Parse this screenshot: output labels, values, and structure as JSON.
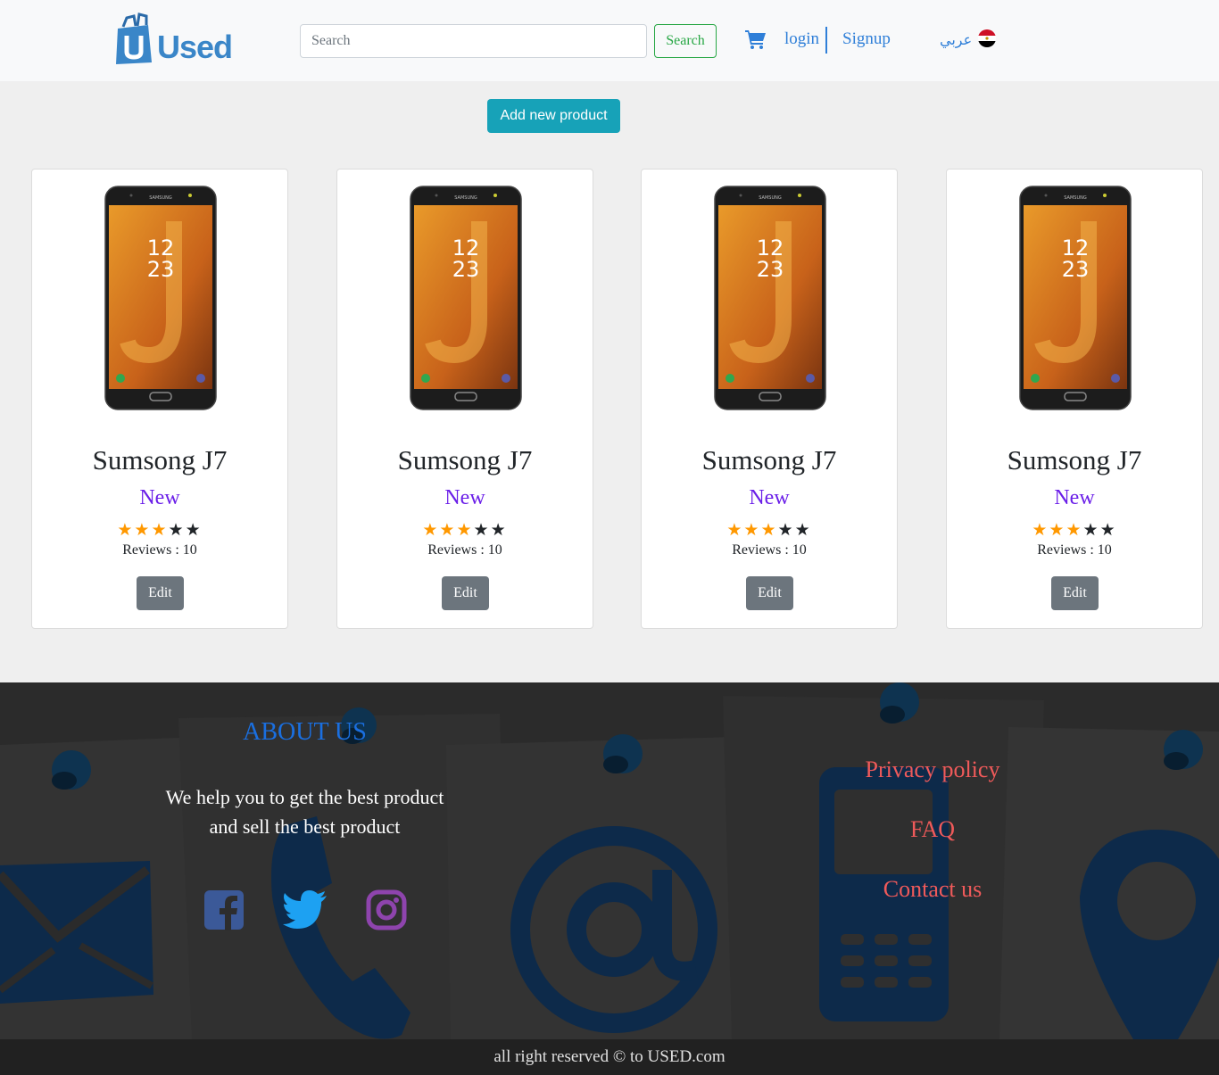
{
  "navbar": {
    "logo_text": "Used",
    "search_placeholder": "Search",
    "search_button": "Search",
    "cart_icon": "cart-icon",
    "login": "login",
    "signup": "Signup",
    "language": "عربي",
    "flag_icon": "egypt-flag-icon"
  },
  "add_product_button": "Add new product",
  "products": [
    {
      "title": "Sumsong J7",
      "condition": "New",
      "rating": 3,
      "max_rating": 5,
      "reviews_label": "Reviews : 10",
      "edit": "Edit",
      "image": "samsung-phone-image"
    },
    {
      "title": "Sumsong J7",
      "condition": "New",
      "rating": 3,
      "max_rating": 5,
      "reviews_label": "Reviews : 10",
      "edit": "Edit",
      "image": "samsung-phone-image"
    },
    {
      "title": "Sumsong J7",
      "condition": "New",
      "rating": 3,
      "max_rating": 5,
      "reviews_label": "Reviews : 10",
      "edit": "Edit",
      "image": "samsung-phone-image"
    },
    {
      "title": "Sumsong J7",
      "condition": "New",
      "rating": 3,
      "max_rating": 5,
      "reviews_label": "Reviews : 10",
      "edit": "Edit",
      "image": "samsung-phone-image"
    }
  ],
  "phone_screen": {
    "hour": "12",
    "minute": "23",
    "brand": "SAMSUNG"
  },
  "footer": {
    "about_title": "ABOUT US",
    "about_line1": "We help you to get the best product",
    "about_line2": "and sell the best product",
    "social": [
      "facebook-icon",
      "twitter-icon",
      "instagram-icon"
    ],
    "links": [
      "Privacy policy",
      "FAQ",
      "Contact us"
    ],
    "copyright": "all right reserved © to USED.com"
  },
  "colors": {
    "accent_blue": "#2f7fd8",
    "add_button": "#17a2b8",
    "condition_purple": "#6a1ee8",
    "star_orange": "#ff9800",
    "footer_link_red": "#f05a5a"
  }
}
